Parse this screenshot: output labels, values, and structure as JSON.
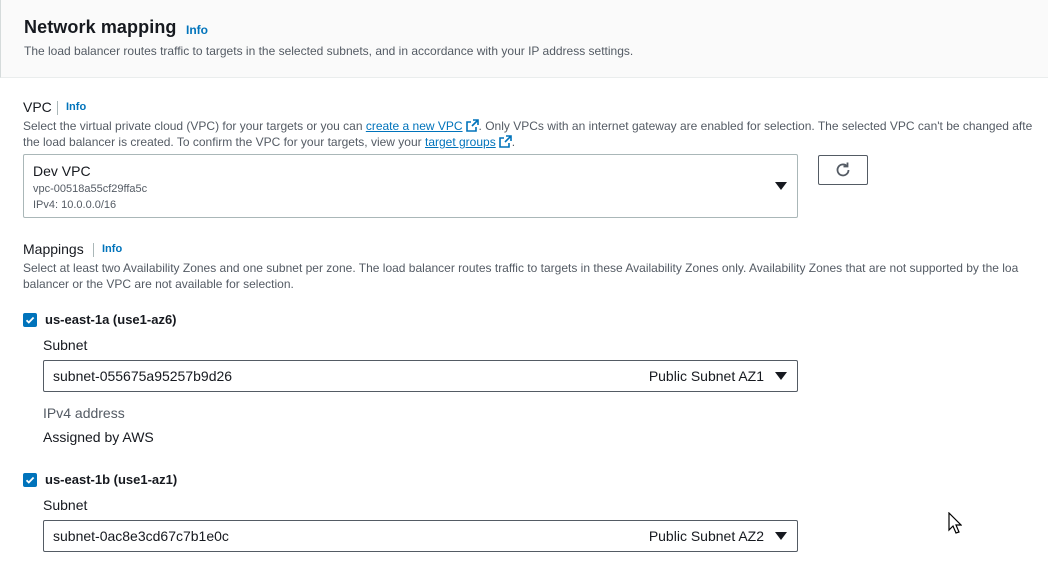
{
  "section": {
    "title": "Network mapping",
    "info": "Info",
    "description": "The load balancer routes traffic to targets in the selected subnets, and in accordance with your IP address settings."
  },
  "vpc": {
    "label": "VPC",
    "info": "Info",
    "help_part1": "Select the virtual private cloud (VPC) for your targets or you can ",
    "help_link1": "create a new VPC",
    "help_part2": ". Only VPCs with an internet gateway are enabled for selection. The selected VPC can't be changed afte",
    "help_part3": "the load balancer is created. To confirm the VPC for your targets, view your ",
    "help_link2": "target groups",
    "help_part4": ".",
    "selected_name": "Dev VPC",
    "selected_id": "vpc-00518a55cf29ffa5c",
    "selected_cidr": "IPv4: 10.0.0.0/16"
  },
  "mappings": {
    "label": "Mappings",
    "info": "Info",
    "help_line1": "Select at least two Availability Zones and one subnet per zone. The load balancer routes traffic to targets in these Availability Zones only. Availability Zones that are not supported by the loa",
    "help_line2": "balancer or the VPC are not available for selection.",
    "zones": [
      {
        "az": "us-east-1a (use1-az6)",
        "subnet_label": "Subnet",
        "subnet_id": "subnet-055675a95257b9d26",
        "subnet_name": "Public Subnet AZ1",
        "ipv4_label": "IPv4 address",
        "ipv4_value": "Assigned by AWS"
      },
      {
        "az": "us-east-1b (use1-az1)",
        "subnet_label": "Subnet",
        "subnet_id": "subnet-0ac8e3cd67c7b1e0c",
        "subnet_name": "Public Subnet AZ2"
      }
    ]
  },
  "colors": {
    "accent": "#0073bb",
    "text": "#16191f",
    "muted": "#545b64",
    "border": "#aab7b8"
  }
}
